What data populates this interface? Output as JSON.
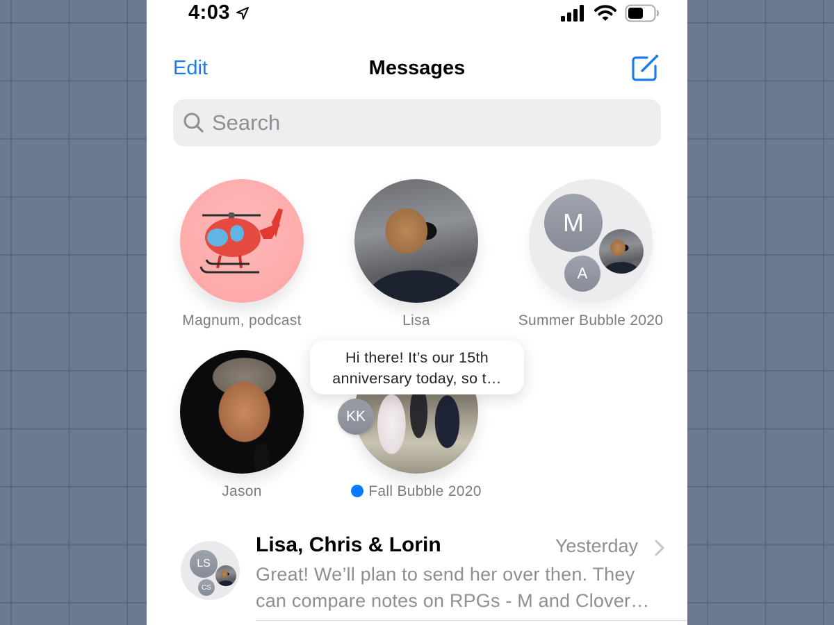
{
  "status_bar": {
    "time": "4:03",
    "location_icon": "location-arrow-icon",
    "signal_icon": "cellular-signal-icon",
    "wifi_icon": "wifi-icon",
    "battery_icon": "battery-icon",
    "battery_level_fraction": 0.6
  },
  "nav": {
    "edit_label": "Edit",
    "title": "Messages",
    "compose_icon": "compose-icon"
  },
  "search": {
    "placeholder": "Search",
    "value": "",
    "icon": "search-icon"
  },
  "pinned": [
    {
      "label": "Magnum, podcast",
      "avatar": "helicopter-emoji",
      "avatar_glyph": "🚁",
      "avatar_bg": "#fda9a9"
    },
    {
      "label": "Lisa",
      "avatar": "photo"
    },
    {
      "label": "Summer Bubble 2020",
      "avatar": "group",
      "members": [
        "M",
        "A",
        "photo"
      ]
    },
    {
      "label": "Jason",
      "avatar": "photo"
    },
    {
      "label": "Fall Bubble 2020",
      "avatar": "photo",
      "unread": true,
      "typing_member": "KK",
      "preview_bubble": "Hi there!  It’s our 15th anniversary today, so t…"
    }
  ],
  "conversations": [
    {
      "name": "Lisa, Chris & Lorin",
      "time": "Yesterday",
      "preview": "Great! We’ll plan to send her over then. They can compare notes on RPGs - M and Clover…",
      "members": [
        "LS",
        "CS",
        "photo"
      ]
    }
  ],
  "colors": {
    "accent": "#1a7ce6",
    "unread_dot": "#0a7aff",
    "secondary_text": "#8e8e93",
    "monogram_bg": "#8f939d",
    "search_bg": "#eeeef0",
    "backdrop": "#6b7a91"
  }
}
